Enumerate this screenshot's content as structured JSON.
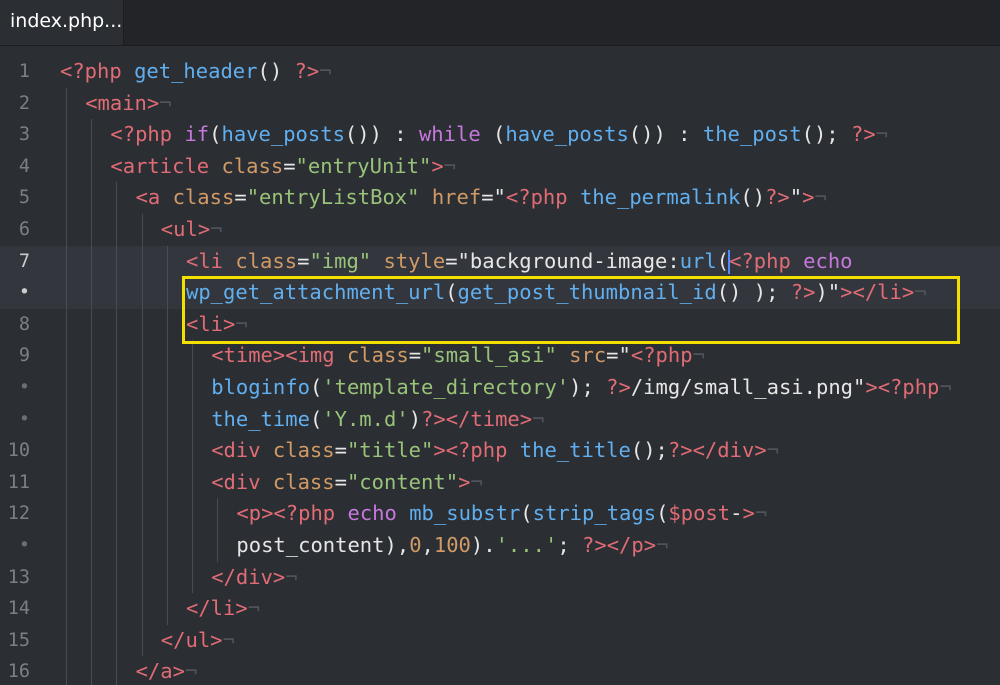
{
  "tab": {
    "title": "index.php..."
  },
  "line_numbers": [
    "1",
    "2",
    "3",
    "4",
    "5",
    "6",
    "7",
    "•",
    "8",
    "9",
    "•",
    "•",
    "10",
    "11",
    "12",
    "•",
    "13",
    "14",
    "15",
    "16"
  ],
  "code_lines": [
    "<?php get_header() ?>",
    "<main>",
    "<?php if(have_posts()) : while (have_posts()) : the_post(); ?>",
    "<article class=\"entryUnit\">",
    "<a class=\"entryListBox\" href=\"<?php the_permalink()?>\">",
    "<ul>",
    "<li class=\"img\" style=\"background-image:url(<?php echo",
    "wp_get_attachment_url(get_post_thumbnail_id() ); ?>)\"></li>",
    "<li>",
    "<time><img class=\"small_asi\" src=\"<?php",
    "bloginfo('template_directory'); ?>/img/small_asi.png\"><?php",
    "the_time('Y.m.d')?></time>",
    "<div class=\"title\"><?php the_title();?></div>",
    "<div class=\"content\">",
    "<p><?php echo mb_substr(strip_tags($post->",
    "post_content),0,100).'...'; ?></p>",
    "</div>",
    "</li>",
    "</ul>",
    "</a>"
  ],
  "colors": {
    "background": "#2b2e33",
    "highlight_box": "#f4e000",
    "tag": "#e06c75",
    "function": "#61afef",
    "keyword": "#c678dd",
    "attribute": "#d19a66",
    "string": "#98c379"
  }
}
